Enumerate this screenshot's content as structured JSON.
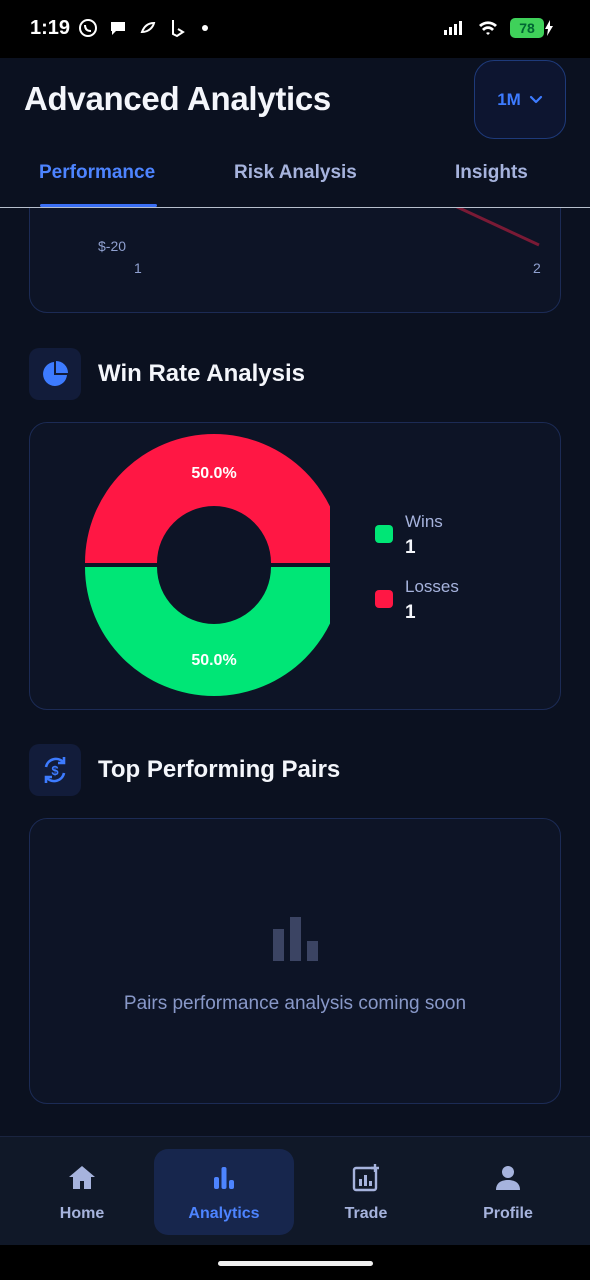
{
  "status_bar": {
    "time": "1:19",
    "battery": "78"
  },
  "header": {
    "title": "Advanced Analytics",
    "period": "1M"
  },
  "tabs": [
    {
      "label": "Performance",
      "active": true
    },
    {
      "label": "Risk Analysis",
      "active": false
    },
    {
      "label": "Insights",
      "active": false
    }
  ],
  "pnl_chart": {
    "y_tick": "$-20",
    "x_ticks": [
      "1",
      "2"
    ],
    "line_color": "#7a1a35"
  },
  "win_rate": {
    "title": "Win Rate Analysis",
    "legend": [
      {
        "name": "Wins",
        "count": "1",
        "color": "#00e676"
      },
      {
        "name": "Losses",
        "count": "1",
        "color": "#ff1744"
      }
    ],
    "slices": [
      {
        "label": "50.0%",
        "value": 50,
        "color": "#ff1744"
      },
      {
        "label": "50.0%",
        "value": 50,
        "color": "#00e676"
      }
    ]
  },
  "top_pairs": {
    "title": "Top Performing Pairs",
    "message": "Pairs performance analysis coming soon"
  },
  "nav": [
    {
      "label": "Home",
      "icon": "home-icon",
      "active": false
    },
    {
      "label": "Analytics",
      "icon": "bar-chart-icon",
      "active": true
    },
    {
      "label": "Trade",
      "icon": "trade-icon",
      "active": false
    },
    {
      "label": "Profile",
      "icon": "profile-icon",
      "active": false
    }
  ],
  "colors": {
    "accent": "#3d7bff",
    "background": "#0b1120",
    "card": "#0d1426"
  }
}
